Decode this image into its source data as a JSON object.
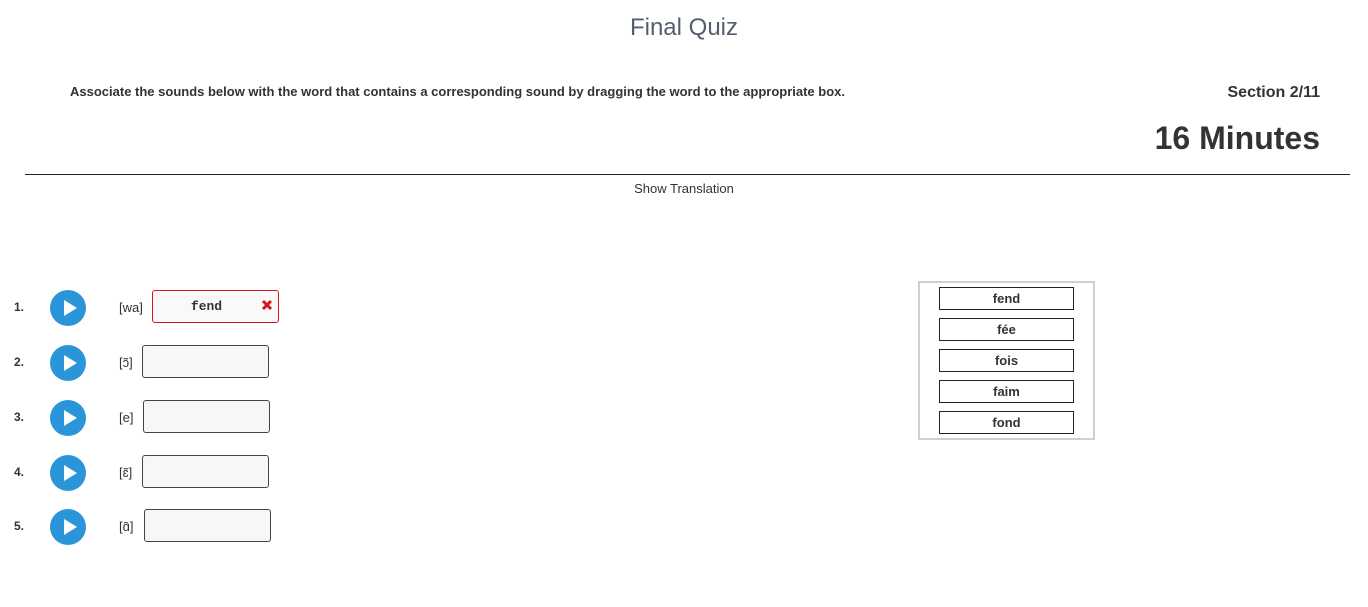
{
  "page": {
    "title": "Final Quiz",
    "instructions": "Associate the sounds below with the word that contains a corresponding sound by dragging the word to the appropriate box.",
    "section": "Section 2/11",
    "timer": "16 Minutes",
    "show_translation": "Show Translation"
  },
  "questions": [
    {
      "number": "1.",
      "sound": "[wa]",
      "answer": "fend",
      "status": "incorrect"
    },
    {
      "number": "2.",
      "sound": "[ɔ̃]",
      "answer": ""
    },
    {
      "number": "3.",
      "sound": "[e]",
      "answer": ""
    },
    {
      "number": "4.",
      "sound": "[ɛ̃]",
      "answer": ""
    },
    {
      "number": "5.",
      "sound": "[ɑ̃]",
      "answer": ""
    }
  ],
  "word_bank": [
    "fend",
    "fée",
    "fois",
    "faim",
    "fond"
  ],
  "colors": {
    "play_button": "#2b95d9",
    "incorrect": "#d9131b",
    "title": "#555e6e"
  },
  "icons": {
    "play": "play-icon",
    "incorrect": "x-icon"
  }
}
